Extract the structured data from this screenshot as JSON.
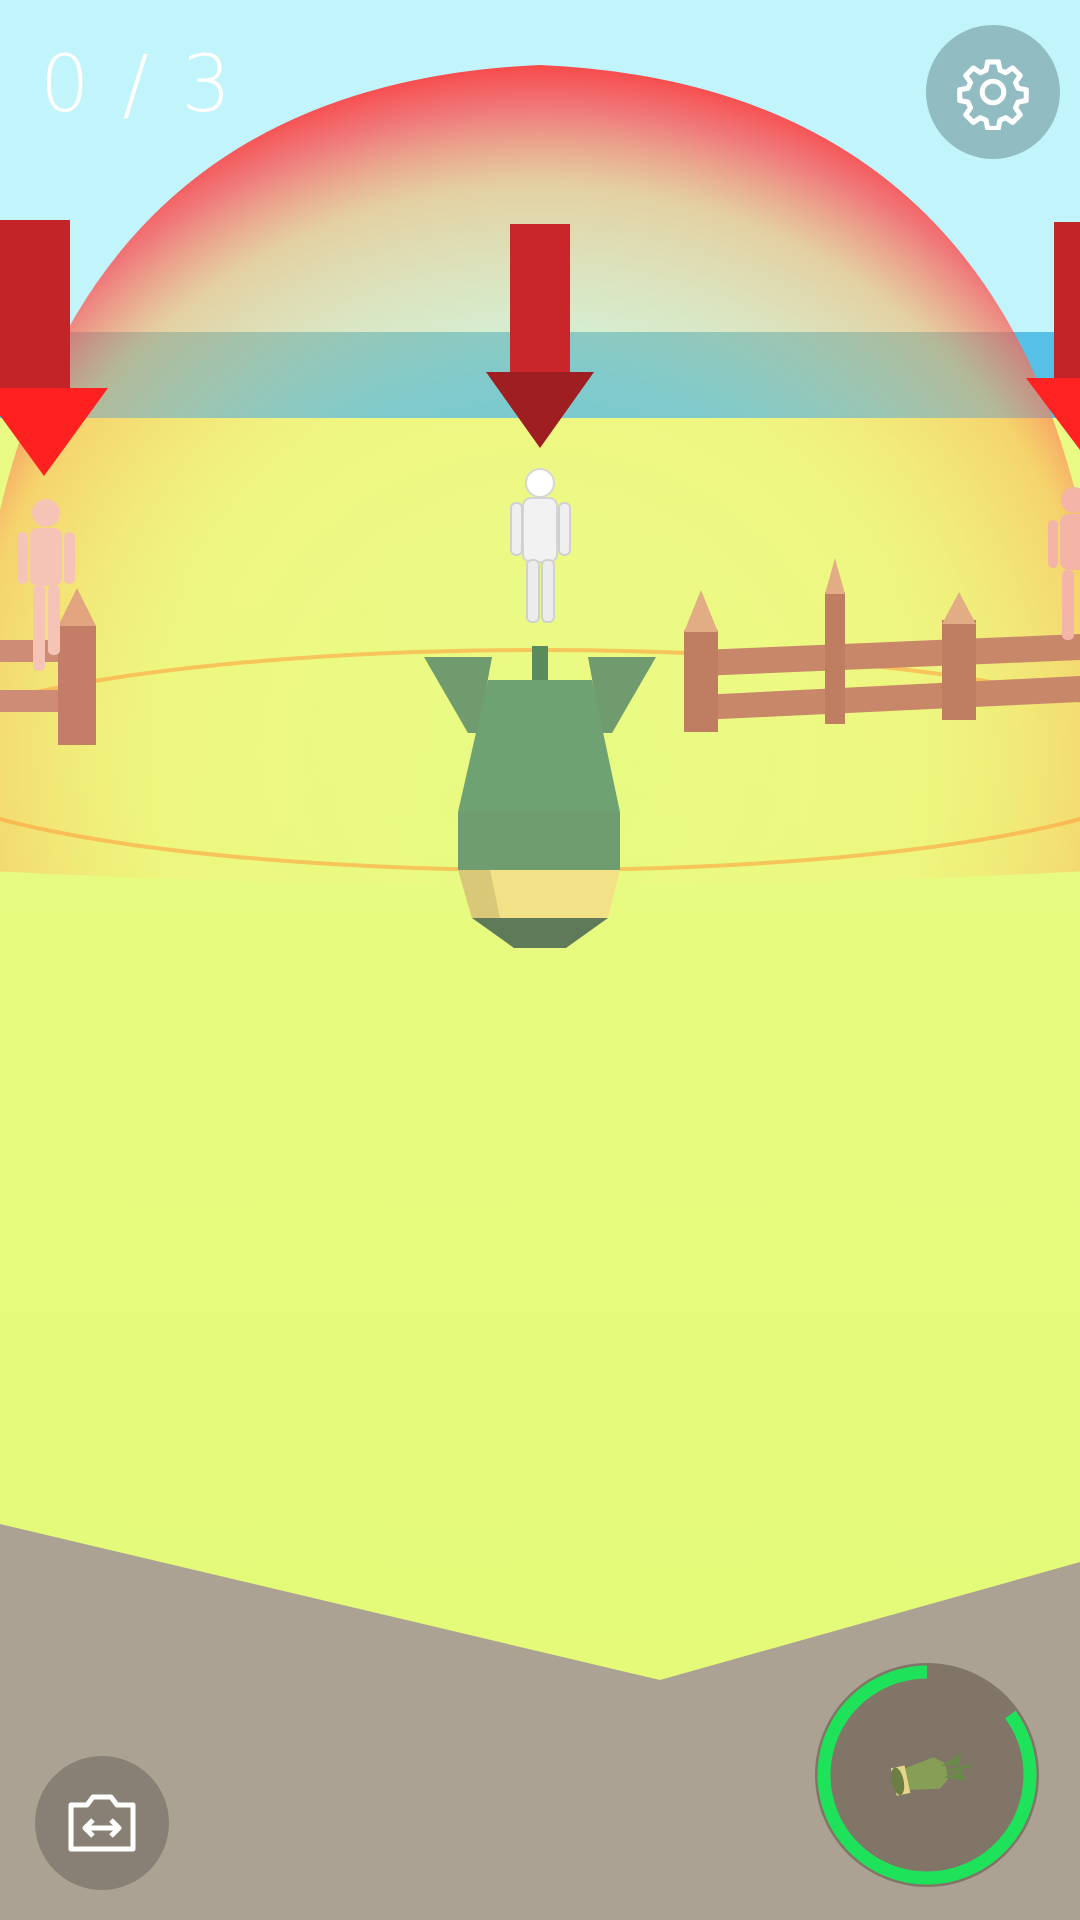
{
  "hud": {
    "counter_text": "0 / 3",
    "targets_found": 0,
    "targets_total": 3
  },
  "buttons": {
    "settings_icon": "gear-icon",
    "camera_icon": "camera-switch-icon",
    "bomb_icon": "bomb-icon"
  },
  "bomb_cooldown": {
    "progress": 0.85,
    "ring_color": "#1ee35a"
  },
  "colors": {
    "sky": "#bff3fb",
    "sea": "#56c0e6",
    "grass": "#e6fb7c",
    "ground": "#aca293",
    "dome": "#ff3a3a",
    "arrow": "#c8262b",
    "bomb_body": "#6fa273",
    "fence": "#c9876a"
  }
}
